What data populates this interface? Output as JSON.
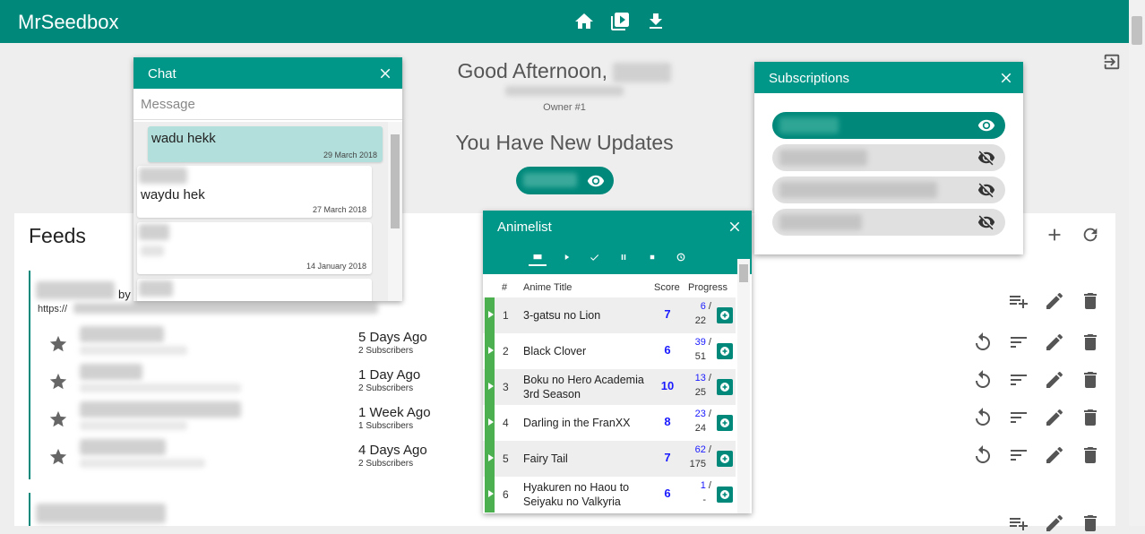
{
  "app": {
    "brand": "MrSeedbox"
  },
  "nav": {
    "icons": [
      "home-icon",
      "video-library-icon",
      "download-icon"
    ]
  },
  "greeting": {
    "hello": "Good Afternoon,",
    "role": "Owner #1"
  },
  "updates": {
    "heading": "You Have New Updates"
  },
  "feeds": {
    "title": "Feeds",
    "by_label": "by",
    "url_prefix": "https://",
    "items": [
      {
        "ago": "5 Days Ago",
        "subscribers": "2 Subscribers"
      },
      {
        "ago": "1 Day Ago",
        "subscribers": "2 Subscribers"
      },
      {
        "ago": "1 Week Ago",
        "subscribers": "1 Subscribers"
      },
      {
        "ago": "4 Days Ago",
        "subscribers": "2 Subscribers"
      }
    ]
  },
  "chat": {
    "title": "Chat",
    "placeholder": "Message",
    "messages": [
      {
        "text": "wadu hekk",
        "date": "29 March 2018",
        "mine": true
      },
      {
        "text": "waydu hek",
        "date": "27 March 2018",
        "mine": false
      },
      {
        "text": "",
        "date": "14 January 2018",
        "mine": false
      }
    ]
  },
  "subscriptions": {
    "title": "Subscriptions",
    "items": [
      {
        "visible": true
      },
      {
        "visible": false
      },
      {
        "visible": false
      },
      {
        "visible": false
      }
    ]
  },
  "animelist": {
    "title": "Animelist",
    "tabs": [
      "list-icon",
      "play-icon",
      "check-icon",
      "pause-icon",
      "stop-icon",
      "clock-icon"
    ],
    "columns": {
      "num": "#",
      "title": "Anime Title",
      "score": "Score",
      "progress": "Progress"
    },
    "rows": [
      {
        "num": "1",
        "title": "3-gatsu no Lion",
        "score": "7",
        "watched": "6",
        "total": "22"
      },
      {
        "num": "2",
        "title": "Black Clover",
        "score": "6",
        "watched": "39",
        "total": "51"
      },
      {
        "num": "3",
        "title": "Boku no Hero Academia 3rd Season",
        "score": "10",
        "watched": "13",
        "total": "25"
      },
      {
        "num": "4",
        "title": "Darling in the FranXX",
        "score": "8",
        "watched": "23",
        "total": "24"
      },
      {
        "num": "5",
        "title": "Fairy Tail",
        "score": "7",
        "watched": "62",
        "total": "175"
      },
      {
        "num": "6",
        "title": "Hyakuren no Haou to Seiyaku no Valkyria",
        "score": "6",
        "watched": "1",
        "total": "-"
      }
    ]
  },
  "colors": {
    "primary": "#00897b",
    "accent_blue": "#1a1aff",
    "status_green": "#4caf50"
  }
}
